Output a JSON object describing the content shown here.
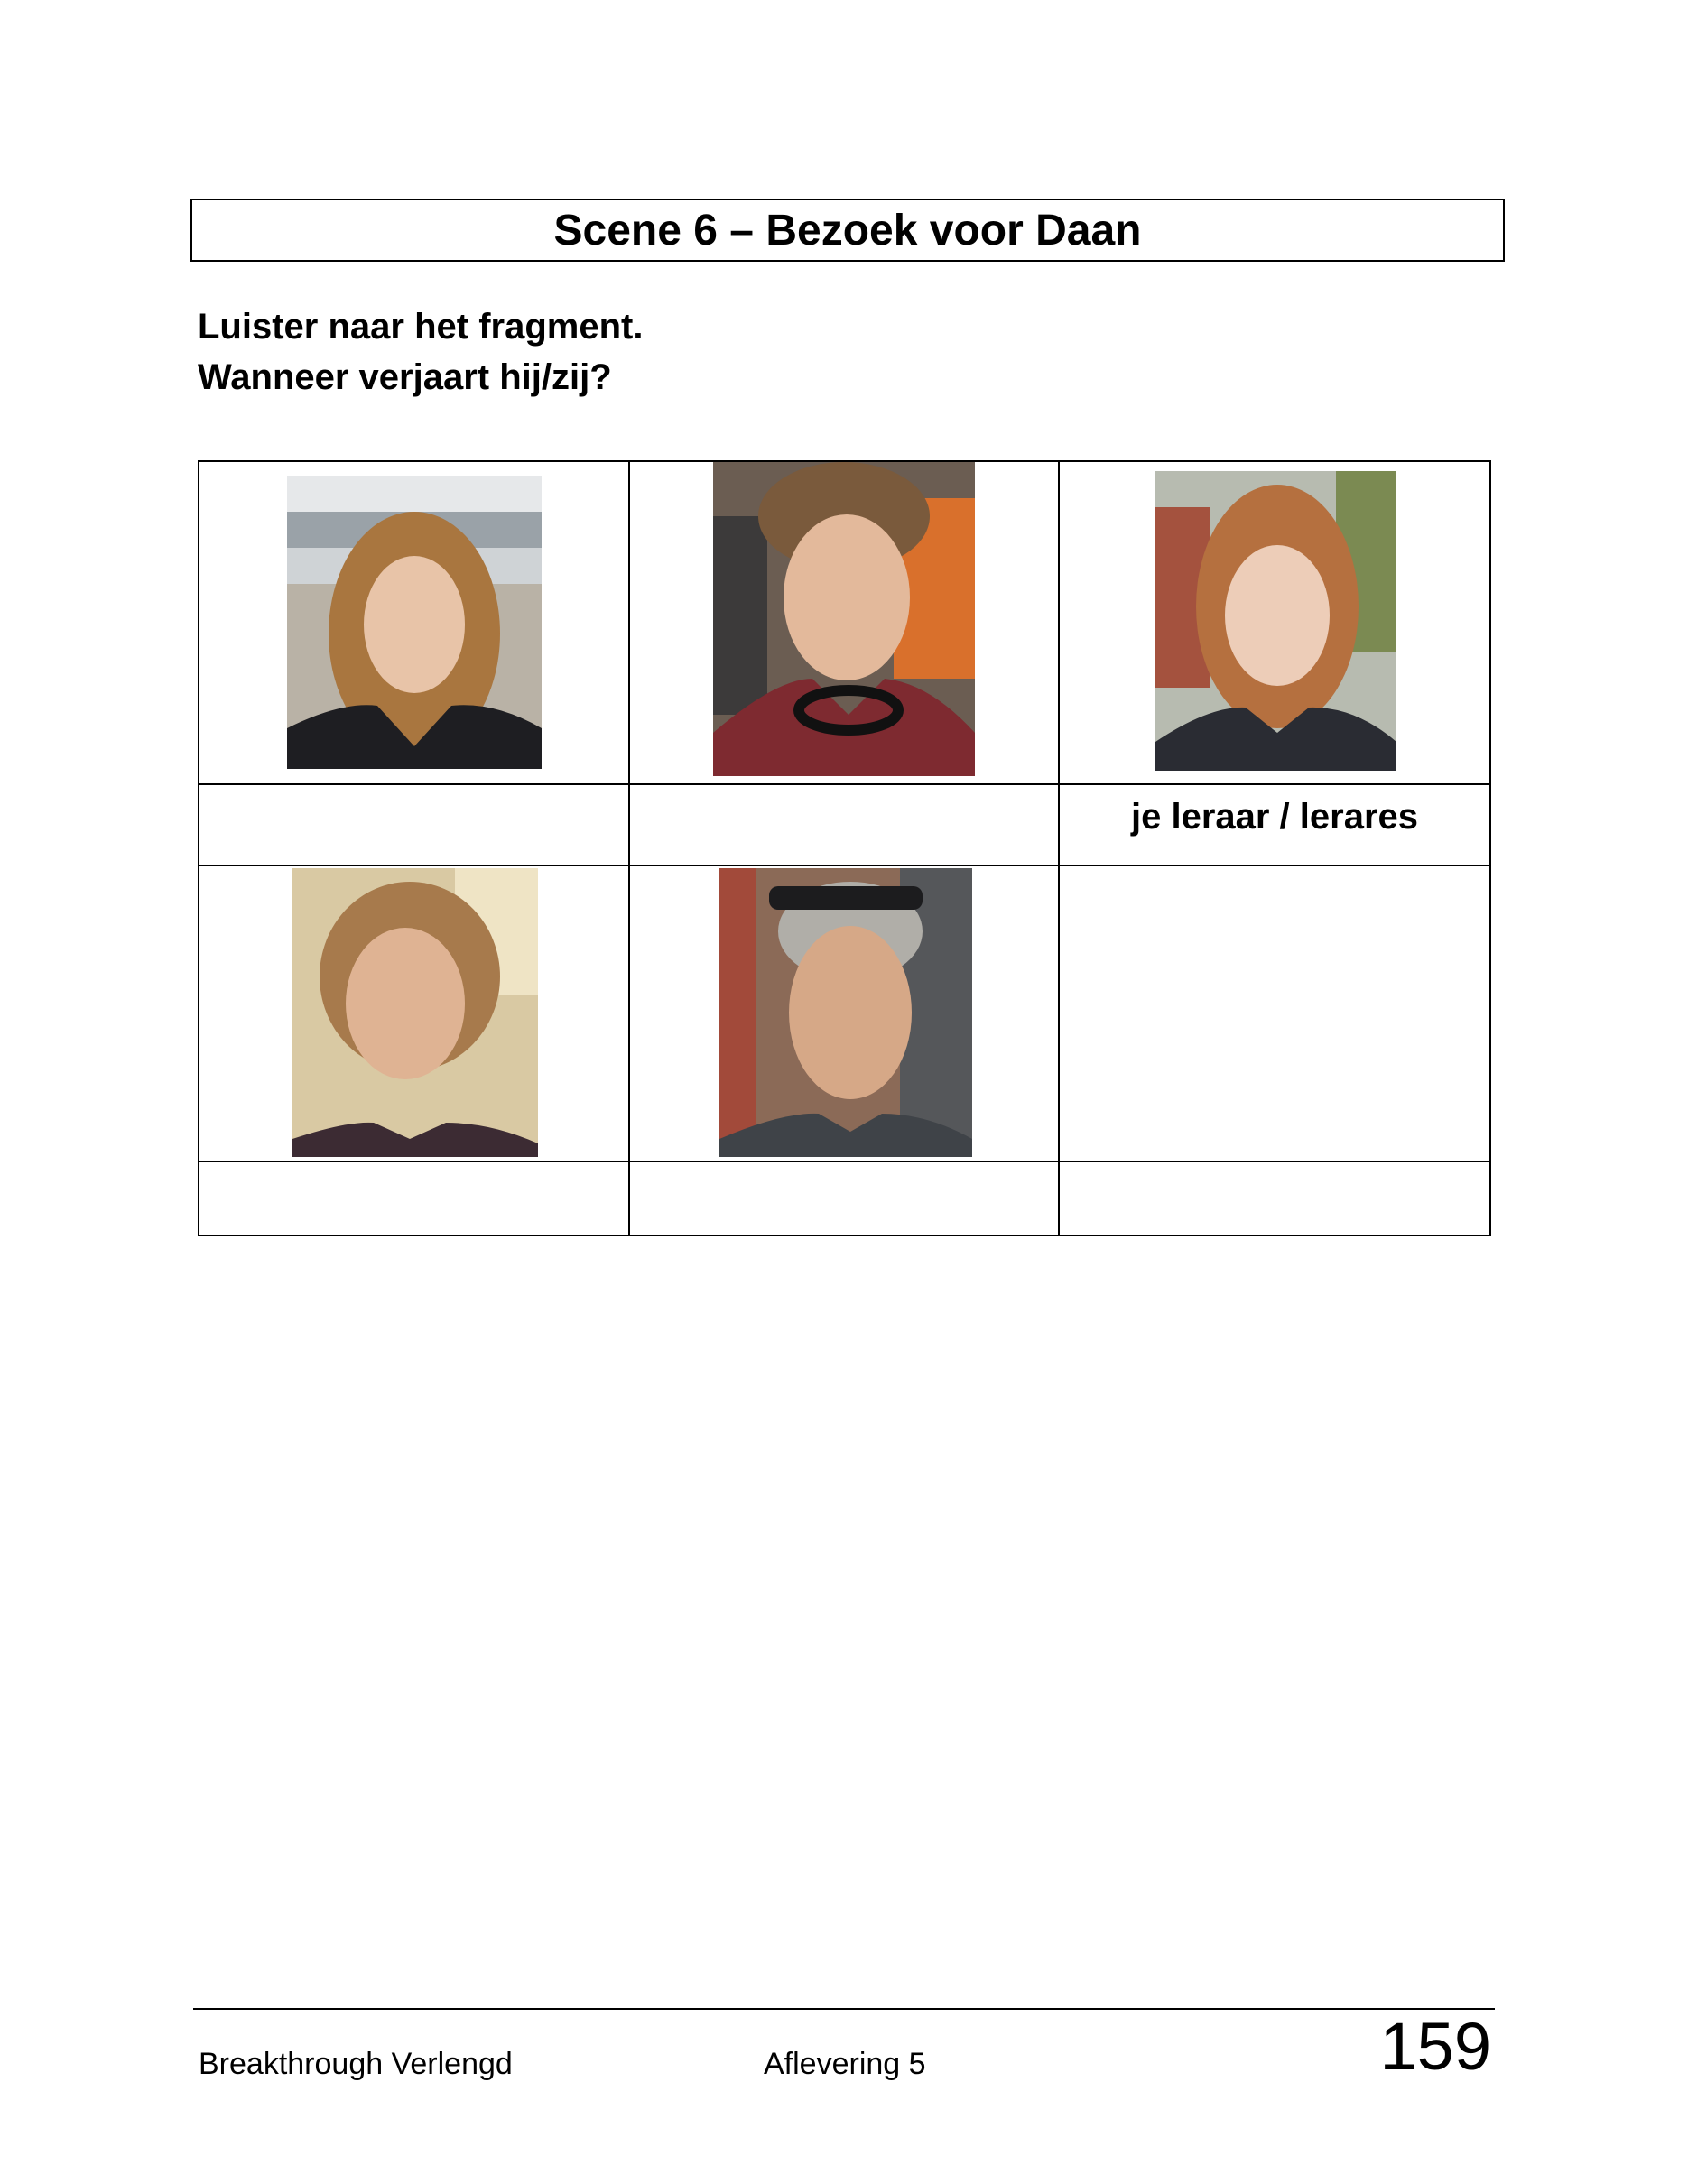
{
  "title": "Scene 6 – Bezoek voor Daan",
  "instructions": {
    "line1": "Luister naar het fragment.",
    "line2": "Wanneer verjaart hij/zij?"
  },
  "table": {
    "cell_label": "je leraar / lerares"
  },
  "footer": {
    "book": "Breakthrough Verlengd",
    "episode": "Aflevering 5",
    "page_number": "159"
  }
}
